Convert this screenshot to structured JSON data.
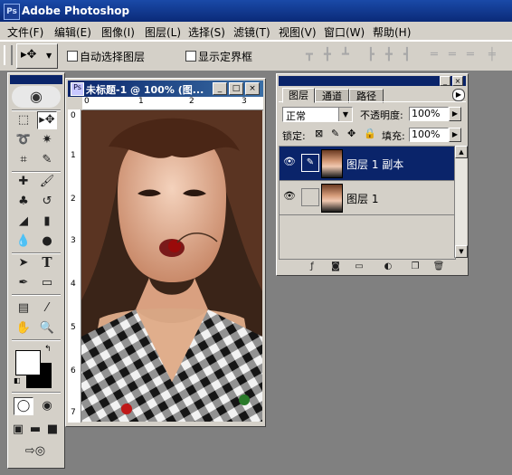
{
  "app": {
    "title": "Adobe Photoshop",
    "logo": "Ps"
  },
  "menu": [
    "文件(F)",
    "编辑(E)",
    "图像(I)",
    "图层(L)",
    "选择(S)",
    "滤镜(T)",
    "视图(V)",
    "窗口(W)",
    "帮助(H)"
  ],
  "options": {
    "auto_select_label": "自动选择图层",
    "show_bounds_label": "显示定界框"
  },
  "document": {
    "title": "未标题-1 @ 100% (图...",
    "ruler_top": [
      "0",
      "1",
      "2",
      "3"
    ],
    "ruler_left": [
      "0",
      "1",
      "2",
      "3",
      "4",
      "5",
      "6",
      "7"
    ]
  },
  "layers_panel": {
    "tabs": [
      "图层",
      "通道",
      "路径"
    ],
    "blend_mode": "正常",
    "opacity_label": "不透明度:",
    "opacity_value": "100%",
    "lock_label": "锁定:",
    "fill_label": "填充:",
    "fill_value": "100%",
    "layers": [
      {
        "name": "图层 1 副本",
        "selected": true
      },
      {
        "name": "图层 1",
        "selected": false
      }
    ]
  }
}
